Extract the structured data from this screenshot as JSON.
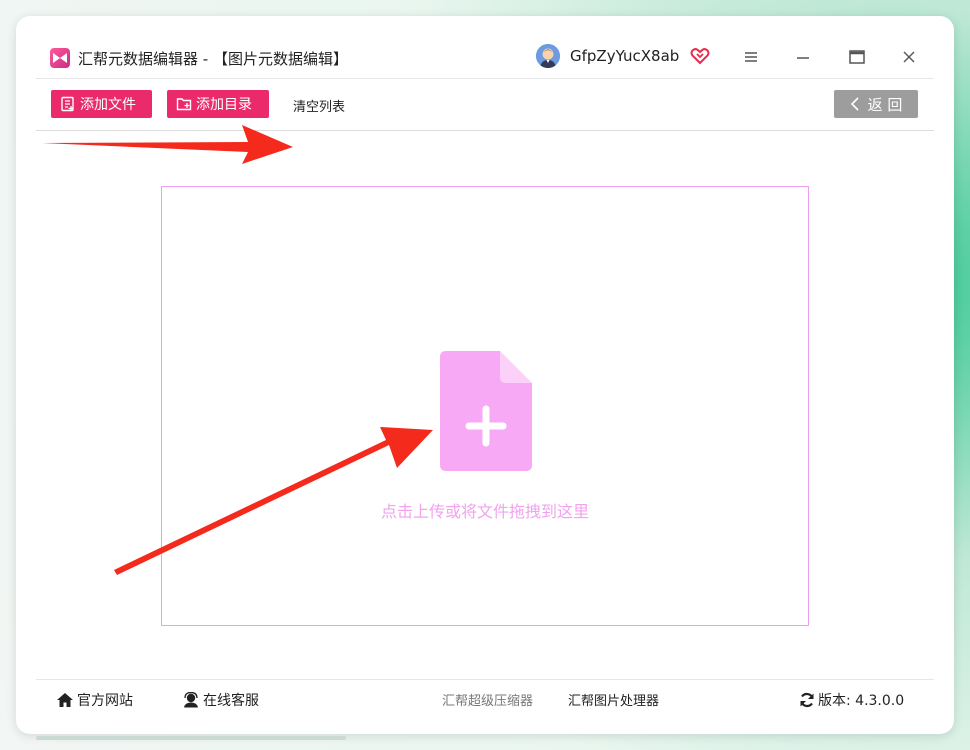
{
  "window": {
    "title": "汇帮元数据编辑器 - 【图片元数据编辑】",
    "username": "GfpZyYucX8ab"
  },
  "toolbar": {
    "add_file": "添加文件",
    "add_dir": "添加目录",
    "clear_list": "清空列表",
    "back": "返 回"
  },
  "dropzone": {
    "text": "点击上传或将文件拖拽到这里"
  },
  "footer": {
    "website": "官方网站",
    "service": "在线客服",
    "compressor": "汇帮超级压缩器",
    "image_processor": "汇帮图片处理器",
    "version": "版本: 4.3.0.0"
  },
  "colors": {
    "accent_pink": "#ea2a6b",
    "drop_pink": "#f8a9f5",
    "back_gray": "#9d9d9d",
    "arrow_red": "#f42a1c"
  }
}
